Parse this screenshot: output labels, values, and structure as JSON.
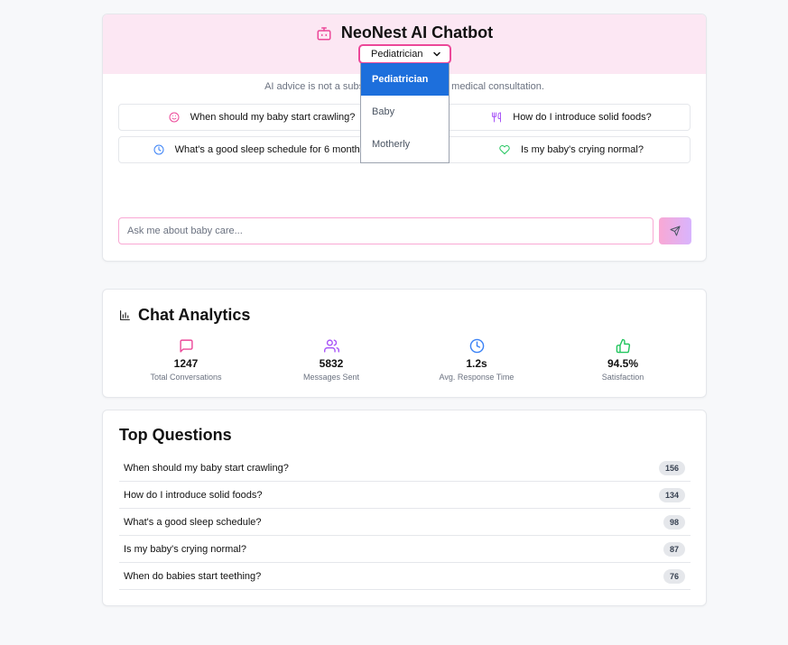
{
  "chat": {
    "title": "NeoNest AI Chatbot",
    "selected_mode": "Pediatrician",
    "dropdown_options": [
      "Pediatrician",
      "Baby",
      "Motherly"
    ],
    "disclaimer_left": "AI advice is not a subs",
    "disclaimer_right": "medical consultation.",
    "quick_questions": [
      {
        "label": "When should my baby start crawling?",
        "icon": "smile-icon"
      },
      {
        "label": "How do I introduce solid foods?",
        "icon": "utensils-icon"
      },
      {
        "label": "What's a good sleep schedule for 6 months?",
        "icon": "clock-icon"
      },
      {
        "label": "Is my baby's crying normal?",
        "icon": "heart-icon"
      }
    ],
    "input_placeholder": "Ask me about baby care..."
  },
  "analytics": {
    "title": "Chat Analytics",
    "stats": [
      {
        "value": "1247",
        "label": "Total Conversations",
        "icon": "message-square-icon",
        "color": "#ec4899"
      },
      {
        "value": "5832",
        "label": "Messages Sent",
        "icon": "users-icon",
        "color": "#a855f7"
      },
      {
        "value": "1.2s",
        "label": "Avg. Response Time",
        "icon": "clock-icon",
        "color": "#3b82f6"
      },
      {
        "value": "94.5%",
        "label": "Satisfaction",
        "icon": "thumbs-up-icon",
        "color": "#22c55e"
      }
    ]
  },
  "top_questions": {
    "title": "Top Questions",
    "items": [
      {
        "question": "When should my baby start crawling?",
        "count": "156"
      },
      {
        "question": "How do I introduce solid foods?",
        "count": "134"
      },
      {
        "question": "What's a good sleep schedule?",
        "count": "98"
      },
      {
        "question": "Is my baby's crying normal?",
        "count": "87"
      },
      {
        "question": "When do babies start teething?",
        "count": "76"
      }
    ]
  },
  "colors": {
    "accent": "#ec4899",
    "header_bg": "#fce7f3",
    "dropdown_selected": "#1d6fdc"
  }
}
